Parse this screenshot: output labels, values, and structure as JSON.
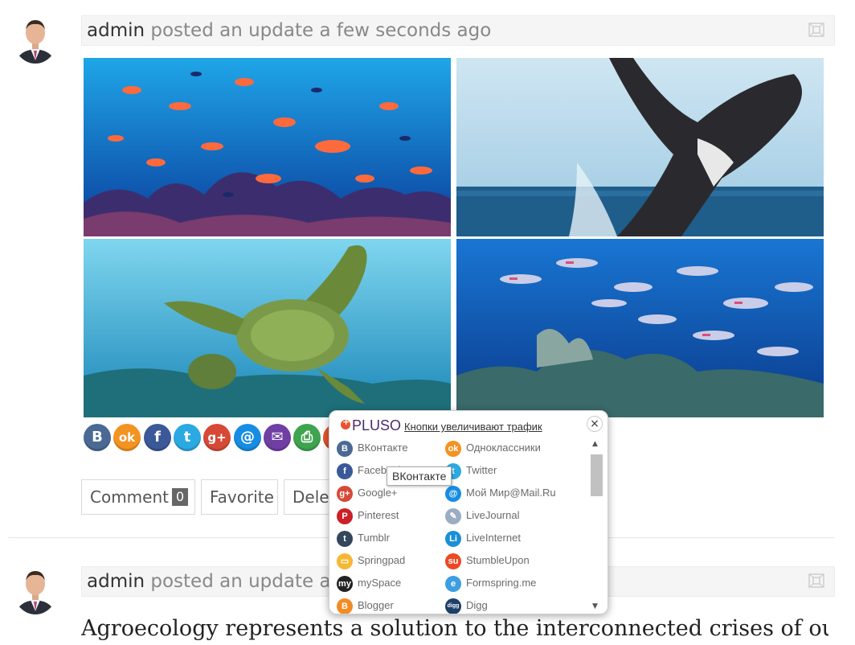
{
  "posts": [
    {
      "author": "admin",
      "meta": " posted an update a few seconds ago",
      "actions": {
        "comment_label": "Comment",
        "comment_count": "0",
        "favorite_label": "Favorite",
        "delete_label": "Delete"
      }
    },
    {
      "author": "admin",
      "meta": " posted an update a few seconds ago",
      "text": "Agroecology represents a solution to the interconnected crises of our"
    }
  ],
  "share_buttons": [
    {
      "icon": "vkontakte-icon",
      "glyph": "B",
      "color": "#4a6a94"
    },
    {
      "icon": "odnoklassniki-icon",
      "glyph": "ok",
      "color": "#f39321"
    },
    {
      "icon": "facebook-icon",
      "glyph": "f",
      "color": "#3b5998"
    },
    {
      "icon": "twitter-icon",
      "glyph": "t",
      "color": "#2ba9e1"
    },
    {
      "icon": "google-plus-icon",
      "glyph": "g+",
      "color": "#d64937"
    },
    {
      "icon": "mail-at-icon",
      "glyph": "@",
      "color": "#168de2"
    },
    {
      "icon": "email-icon",
      "glyph": "✉",
      "color": "#6f3fa4"
    },
    {
      "icon": "print-icon",
      "glyph": "⎙",
      "color": "#3ea44d"
    },
    {
      "icon": "more-icon",
      "glyph": "+",
      "color": "#e8532f"
    }
  ],
  "pluso": {
    "logo": "PLUSO",
    "tagline": "Кнопки увеличивают трафик",
    "close": "×",
    "tooltip": "ВКонтакте",
    "items": [
      {
        "label": "ВКонтакте",
        "icon": "vkontakte-icon",
        "glyph": "B",
        "color": "#4a6a94"
      },
      {
        "label": "Одноклассники",
        "icon": "odnoklassniki-icon",
        "glyph": "ok",
        "color": "#f39321"
      },
      {
        "label": "Facebook",
        "icon": "facebook-icon",
        "glyph": "f",
        "color": "#3b5998"
      },
      {
        "label": "Twitter",
        "icon": "twitter-icon",
        "glyph": "t",
        "color": "#2ba9e1"
      },
      {
        "label": "Google+",
        "icon": "google-plus-icon",
        "glyph": "g+",
        "color": "#d64937"
      },
      {
        "label": "Мой Мир@Mail.Ru",
        "icon": "moi-mir-icon",
        "glyph": "@",
        "color": "#168de2"
      },
      {
        "label": "Pinterest",
        "icon": "pinterest-icon",
        "glyph": "P",
        "color": "#cb2027"
      },
      {
        "label": "LiveJournal",
        "icon": "livejournal-icon",
        "glyph": "✎",
        "color": "#9aadc3"
      },
      {
        "label": "Tumblr",
        "icon": "tumblr-icon",
        "glyph": "t",
        "color": "#35465c"
      },
      {
        "label": "LiveInternet",
        "icon": "liveinternet-icon",
        "glyph": "Li",
        "color": "#1a8fd6"
      },
      {
        "label": "Springpad",
        "icon": "springpad-icon",
        "glyph": "▭",
        "color": "#f7b733"
      },
      {
        "label": "StumbleUpon",
        "icon": "stumbleupon-icon",
        "glyph": "su",
        "color": "#eb4924"
      },
      {
        "label": "mySpace",
        "icon": "myspace-icon",
        "glyph": "my",
        "color": "#222222"
      },
      {
        "label": "Formspring.me",
        "icon": "formspring-icon",
        "glyph": "e",
        "color": "#3d9ee0"
      },
      {
        "label": "Blogger",
        "icon": "blogger-icon",
        "glyph": "B",
        "color": "#f48a23"
      },
      {
        "label": "Digg",
        "icon": "digg-icon",
        "glyph": "digg",
        "color": "#1d3f6a"
      }
    ]
  }
}
